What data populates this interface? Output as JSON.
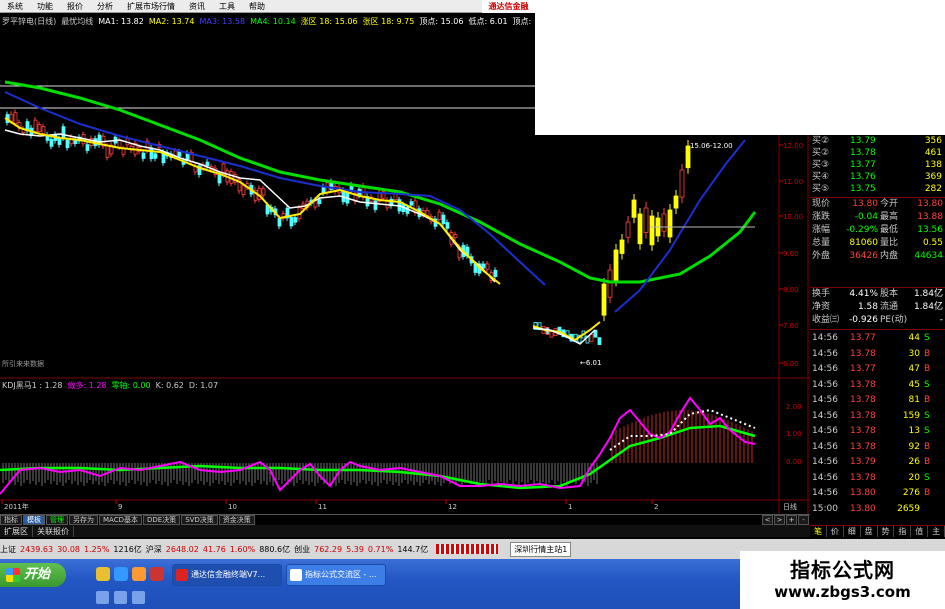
{
  "menu": [
    "系统",
    "功能",
    "报价",
    "分析",
    "扩展市场行情",
    "资讯",
    "工具",
    "帮助"
  ],
  "brand": "通达信金融",
  "info": [
    {
      "text": "罗平锌电(日线)",
      "color": "#cccccc"
    },
    {
      "text": "最忧均线",
      "color": "#cccccc"
    },
    {
      "text": "MA1: 13.82",
      "color": "#ffffff"
    },
    {
      "text": "MA2: 13.74",
      "color": "#ffff00"
    },
    {
      "text": "MA3: 13.58",
      "color": "#4040ff"
    },
    {
      "text": "MA4: 10.14",
      "color": "#00ff00"
    },
    {
      "text": "涨区 18: 15.06",
      "color": "#ffff00"
    },
    {
      "text": "张区 18: 9.75",
      "color": "#ffff00"
    },
    {
      "text": "顶点: 15.06",
      "color": "#ffffff"
    },
    {
      "text": "低点: 6.01",
      "color": "#ffffff"
    },
    {
      "text": "顶点: 15.06",
      "color": "#ffffff"
    },
    {
      "text": "低点: 6.01",
      "color": "#ffffff"
    }
  ],
  "kdj": [
    {
      "text": "KDJ黑马1 : 1.28",
      "color": "#cccccc"
    },
    {
      "text": "做多: 1.28",
      "color": "#ff00ff"
    },
    {
      "text": "零轴: 0.00",
      "color": "#00ff00"
    },
    {
      "text": "K: 0.62",
      "color": "#cccccc"
    },
    {
      "text": "D: 1.07",
      "color": "#cccccc"
    }
  ],
  "price_axis": [
    "12.00",
    "11.00",
    "10.00",
    "9.00",
    "8.00",
    "7.00",
    "6.00"
  ],
  "kdj_axis": [
    "2.00",
    "1.00",
    "0.00"
  ],
  "date_axis": [
    "2011年",
    "9",
    "10",
    "11",
    "12",
    "1",
    "2"
  ],
  "annotations": {
    "low_label": "6.01",
    "high_label": "15.06-12.00",
    "small_label": "所引来来数据"
  },
  "quote": {
    "buys": [
      {
        "label": "买②",
        "price": "13.79",
        "vol": "356"
      },
      {
        "label": "买②",
        "price": "13.78",
        "vol": "461"
      },
      {
        "label": "买③",
        "price": "13.77",
        "vol": "138"
      },
      {
        "label": "买④",
        "price": "13.76",
        "vol": "369"
      },
      {
        "label": "买⑤",
        "price": "13.75",
        "vol": "282"
      }
    ],
    "stats": [
      {
        "l1": "现价",
        "v1": "13.80",
        "c1": "#ff4040",
        "l2": "今开",
        "v2": "13.80",
        "c2": "#ff4040"
      },
      {
        "l1": "涨跌",
        "v1": "-0.04",
        "c1": "#00ff00",
        "l2": "最高",
        "v2": "13.88",
        "c2": "#ff4040"
      },
      {
        "l1": "涨幅",
        "v1": "-0.29%",
        "c1": "#00ff00",
        "l2": "最低",
        "v2": "13.56",
        "c2": "#00ff00"
      },
      {
        "l1": "总量",
        "v1": "81060",
        "c1": "#ffff00",
        "l2": "量比",
        "v2": "0.55",
        "c2": "#ffff00"
      },
      {
        "l1": "外盘",
        "v1": "36426",
        "c1": "#ff4040",
        "l2": "内盘",
        "v2": "44634",
        "c2": "#00ff00"
      }
    ],
    "stats2": [
      {
        "l1": "换手",
        "v1": "4.41%",
        "l2": "股本",
        "v2": "1.84亿"
      },
      {
        "l1": "净资",
        "v1": "1.58",
        "l2": "流通",
        "v2": "1.84亿"
      },
      {
        "l1": "收益㈢",
        "v1": "-0.926",
        "l2": "PE(动)",
        "v2": "-"
      }
    ],
    "ticks": [
      {
        "time": "14:56",
        "price": "13.77",
        "vol": "44",
        "side": "S"
      },
      {
        "time": "14:56",
        "price": "13.78",
        "vol": "30",
        "side": "B"
      },
      {
        "time": "14:56",
        "price": "13.77",
        "vol": "47",
        "side": "B"
      },
      {
        "time": "14:56",
        "price": "13.78",
        "vol": "45",
        "side": "S"
      },
      {
        "time": "14:56",
        "price": "13.78",
        "vol": "81",
        "side": "B"
      },
      {
        "time": "14:56",
        "price": "13.78",
        "vol": "159",
        "side": "S"
      },
      {
        "time": "14:56",
        "price": "13.78",
        "vol": "13",
        "side": "S"
      },
      {
        "time": "14:56",
        "price": "13.78",
        "vol": "92",
        "side": "B"
      },
      {
        "time": "14:56",
        "price": "13.79",
        "vol": "26",
        "side": "B"
      },
      {
        "time": "14:56",
        "price": "13.78",
        "vol": "20",
        "side": "S"
      },
      {
        "time": "14:56",
        "price": "13.80",
        "vol": "276",
        "side": "B"
      },
      {
        "time": "15:00",
        "price": "13.80",
        "vol": "2659",
        "side": ""
      }
    ],
    "tabs": [
      "笔",
      "价",
      "细",
      "盘",
      "势",
      "指",
      "值",
      "主"
    ]
  },
  "tabs": [
    {
      "label": "指标",
      "cls": ""
    },
    {
      "label": "模板",
      "cls": "active"
    },
    {
      "label": "管理",
      "cls": "green"
    },
    {
      "label": "另存为",
      "cls": ""
    },
    {
      "label": "MACD基本",
      "cls": ""
    },
    {
      "label": "DDE决策",
      "cls": ""
    },
    {
      "label": "SVD决策",
      "cls": ""
    },
    {
      "label": "资金决策",
      "cls": ""
    }
  ],
  "tab_arrows": [
    "<",
    ">",
    "+",
    "-"
  ],
  "day_label": "日线",
  "subtabs": [
    "扩展区",
    "关联报价"
  ],
  "index_bar": {
    "sh_label": "上证",
    "sh_val": "2439.63",
    "sh_chg": "30.08",
    "sh_pct": "1.25%",
    "sh_amt": "1216亿",
    "sz_label": "沪深",
    "sz_val": "2648.02",
    "sz_chg": "41.76",
    "sz_pct": "1.60%",
    "sz_amt": "880.6亿",
    "cy_label": "创业",
    "cy_val": "762.29",
    "cy_chg": "5.39",
    "cy_pct": "0.71%",
    "cy_amt": "144.7亿",
    "server": "深圳行情主站1"
  },
  "taskbar": {
    "start": "开始",
    "task1": "通达信金融终端V7...",
    "task2": "指标公式交流区 - ..."
  },
  "watermark": {
    "title": "指标公式网",
    "url": "www.zbgs3.com"
  }
}
